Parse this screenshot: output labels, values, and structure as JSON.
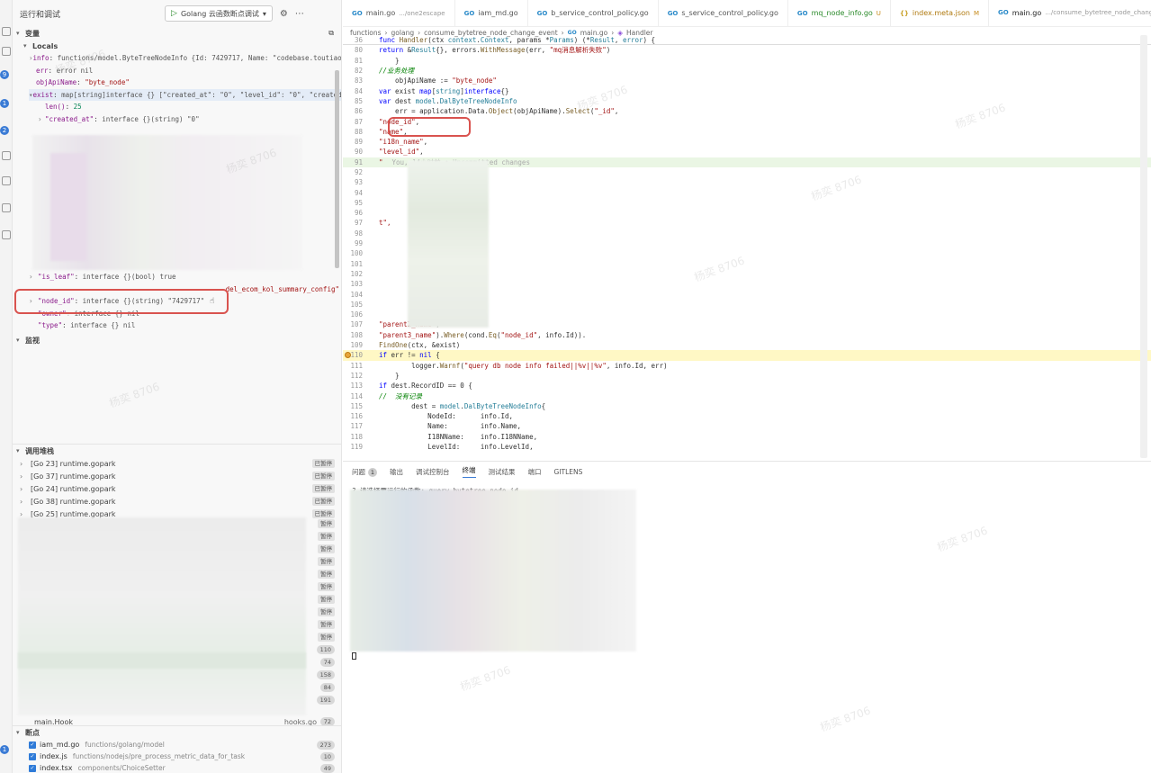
{
  "sidebar": {
    "title": "运行和调试",
    "run_config": "Golang 云函数断点调试",
    "variables_title": "变量",
    "locals_label": "Locals",
    "vars": [
      {
        "name": "info",
        "value": "functions/model.ByteTreeNodeInfo {Id: 7429717, Name: \"codebase.toutiao/bcn…"
      },
      {
        "name": "err",
        "value": "error nil"
      },
      {
        "name": "objApiName",
        "value": "\"byte_node\""
      },
      {
        "name": "exist",
        "value": "map[string]interface {} [\"created_at\": \"0\", \"level_id\": \"0\", \"created_by…"
      },
      {
        "name": "len()",
        "value": "25"
      },
      {
        "name": "\"created_at\"",
        "value": "interface {}(string) \"0\""
      }
    ],
    "vars_lower": [
      {
        "name": "\"is_leaf\"",
        "value": "interface {}(bool) true"
      },
      {
        "name": "",
        "value": "del_ecom_kol_summary_config\""
      },
      {
        "name": "\"node_id\"",
        "value": "interface {}(string) \"7429717\""
      },
      {
        "name": "\"owner\"",
        "value": "interface {} nil"
      },
      {
        "name": "\"type\"",
        "value": "interface {} nil"
      }
    ],
    "watch_title": "监视",
    "callstack_title": "调用堆栈",
    "callstack": [
      {
        "label": "[Go 23] runtime.gopark",
        "status": "已暂停"
      },
      {
        "label": "[Go 37] runtime.gopark",
        "status": "已暂停"
      },
      {
        "label": "[Go 24] runtime.gopark",
        "status": "已暂停"
      },
      {
        "label": "[Go 38] runtime.gopark",
        "status": "已暂停"
      },
      {
        "label": "[Go 25] runtime.gopark",
        "status": "已暂停"
      }
    ],
    "paused_short": "暂停",
    "line_badges": [
      "110",
      "74",
      "158",
      "84",
      "191"
    ],
    "hook_frame": {
      "label": "main.Hook",
      "file": "hooks.go",
      "line": "72"
    },
    "breakpoints_title": "断点",
    "breakpoints": [
      {
        "file": "iam_md.go",
        "path": "functions/golang/model",
        "count": "273"
      },
      {
        "file": "index.js",
        "path": "functions/nodejs/pre_process_metric_data_for_task",
        "count": "10"
      },
      {
        "file": "index.tsx",
        "path": "components/ChoiceSetter",
        "count": "49"
      }
    ]
  },
  "editor": {
    "tabs": [
      {
        "label": "main.go",
        "desc": ".../one2escape",
        "icon": "GO",
        "active": false
      },
      {
        "label": "iam_md.go",
        "desc": "",
        "icon": "GO",
        "active": false
      },
      {
        "label": "b_service_control_policy.go",
        "desc": "",
        "icon": "GO",
        "active": false
      },
      {
        "label": "s_service_control_policy.go",
        "desc": "",
        "icon": "GO",
        "active": false
      },
      {
        "label": "mq_node_info.go",
        "desc": "U",
        "icon": "GO",
        "active": false
      },
      {
        "label": "index.meta.json",
        "desc": "M",
        "icon": "{}",
        "active": false
      },
      {
        "label": "main.go",
        "desc": ".../consume_bytetree_node_change_e",
        "icon": "GO",
        "active": true
      }
    ],
    "breadcrumb": [
      "functions",
      "golang",
      "consume_bytetree_node_change_event",
      "main.go",
      "Handler"
    ],
    "blame": "You, 14小时前 • Uncommitted changes"
  },
  "panel": {
    "tabs": [
      {
        "label": "问题",
        "badge": "1"
      },
      {
        "label": "输出",
        "badge": ""
      },
      {
        "label": "调试控制台",
        "badge": ""
      },
      {
        "label": "终端",
        "badge": ""
      },
      {
        "label": "测试结果",
        "badge": ""
      },
      {
        "label": "端口",
        "badge": ""
      },
      {
        "label": "GITLENS",
        "badge": ""
      }
    ],
    "first_line": "? 请选择要运行的函数: query_bytetree_node_id"
  },
  "watermark": "杨奕 8706",
  "colors": {
    "accent": "#3a7bd5",
    "highlight_box": "#d9534f",
    "current_line": "#fff8c5"
  }
}
